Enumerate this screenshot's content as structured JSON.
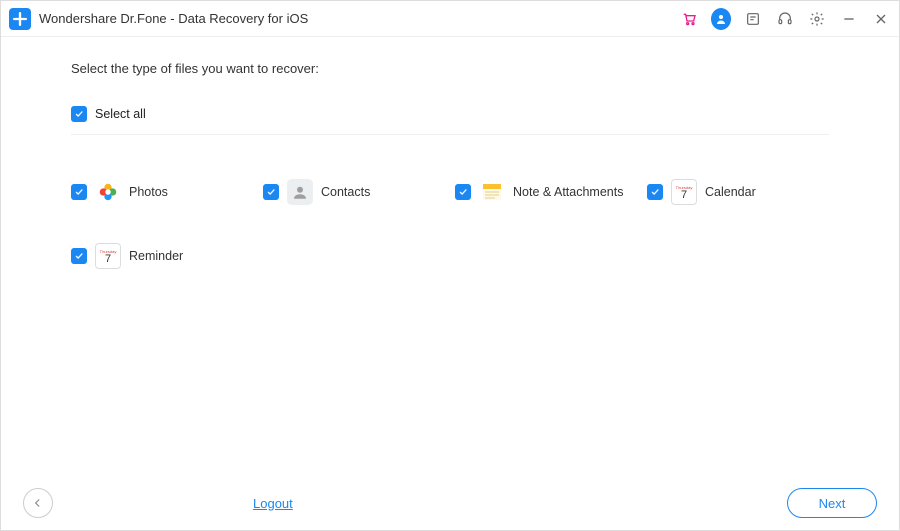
{
  "titlebar": {
    "title": "Wondershare Dr.Fone - Data Recovery for iOS"
  },
  "content": {
    "prompt": "Select the type of files you want to recover:",
    "select_all_label": "Select all"
  },
  "items": [
    {
      "label": "Photos",
      "icon": "photos-icon",
      "checked": true
    },
    {
      "label": "Contacts",
      "icon": "contacts-icon",
      "checked": true
    },
    {
      "label": "Note & Attachments",
      "icon": "notes-icon",
      "checked": true
    },
    {
      "label": "Calendar",
      "icon": "calendar-icon",
      "checked": true
    },
    {
      "label": "Reminder",
      "icon": "reminder-icon",
      "checked": true
    }
  ],
  "calendar_tile": {
    "weekday": "Thursday",
    "day": "7"
  },
  "footer": {
    "logout": "Logout",
    "next": "Next"
  }
}
